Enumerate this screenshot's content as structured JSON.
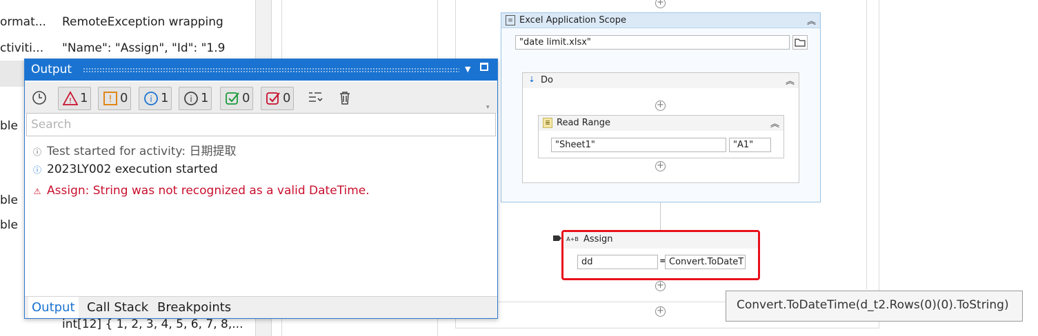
{
  "properties": {
    "rows": [
      {
        "name": "ormat...",
        "value": "RemoteException wrapping"
      },
      {
        "name": "ctiviti...",
        "value": " \"Name\": \"Assign\",  \"Id\": \"1.9"
      },
      {
        "name": "ble",
        "value": ""
      },
      {
        "name": "ble",
        "value": ""
      },
      {
        "name": "ble",
        "value": ""
      },
      {
        "name": "",
        "value": "int[12] { 1, 2, 3, 4, 5, 6, 7, 8,..."
      }
    ]
  },
  "designer": {
    "excel_scope": {
      "title": "Excel Application Scope",
      "path_value": "\"date  limit.xlsx\"",
      "folder_icon": "folder-icon",
      "collapse_icon": "double-chevron-up-icon"
    },
    "do": {
      "title": "Do",
      "collapse_icon": "double-chevron-up-icon"
    },
    "read_range": {
      "title": "Read Range",
      "sheet_value": "\"Sheet1\"",
      "range_value": "\"A1\"",
      "collapse_icon": "double-chevron-up-icon"
    },
    "assign": {
      "title": "Assign",
      "to_value": "dd",
      "equals": "=",
      "expr_value": "Convert.ToDateT",
      "icon_label": "A+B"
    },
    "tooltip": "Convert.ToDateTime(d_t2.Rows(0)(0).ToString)",
    "accent_error": "#e8101a"
  },
  "output": {
    "title": "Output",
    "toolbar": {
      "errors": "1",
      "warnings": "0",
      "info": "1",
      "trace": "1",
      "success": "0",
      "failed": "0"
    },
    "search_placeholder": "Search",
    "logs": [
      {
        "level": "trace",
        "text": "Test started for activity: 日期提取",
        "color": "#555555"
      },
      {
        "level": "info",
        "text": "2023LY002 execution started",
        "color": "#1e1e1e"
      },
      {
        "level": "error",
        "text": "Assign: String was not recognized as a valid DateTime.",
        "color": "#c8102e"
      }
    ],
    "tabs": [
      "Output",
      "Call Stack",
      "Breakpoints"
    ],
    "accent": "#1a73d1"
  }
}
